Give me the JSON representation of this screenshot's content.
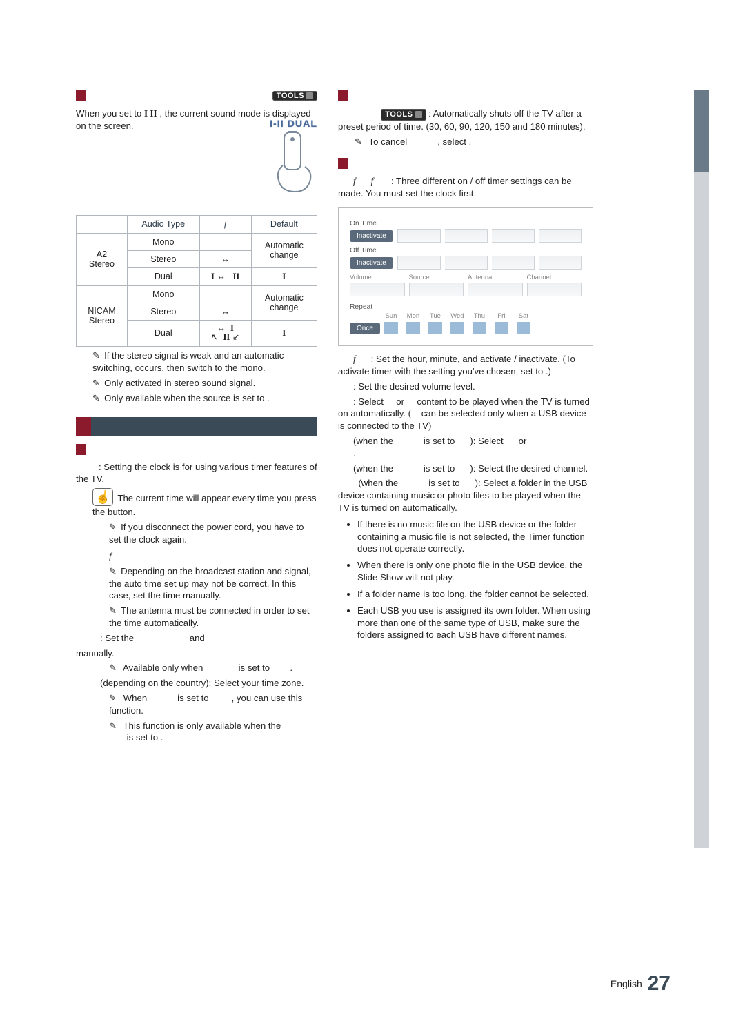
{
  "left_section_1": {
    "tools_label": "TOOLS",
    "intro_a": "When you set to",
    "intro_b": ", the current sound mode is displayed on the screen.",
    "i_ii": "I  II",
    "dual_badge": "I-II DUAL"
  },
  "audio_table": {
    "headers": {
      "col1": "",
      "col2": "Audio Type",
      "col3": "",
      "col4": "Default"
    },
    "a2_rowspan": "A2\nStereo",
    "nicam_rowspan": "NICAM\nStereo",
    "rows_a2": [
      {
        "type": "Mono",
        "mid": "",
        "def": "Automatic"
      },
      {
        "type": "Stereo",
        "mid": "↔",
        "def": "change"
      },
      {
        "type": "Dual",
        "mid_prefix": "I",
        "mid_arrow": "↔",
        "mid_suffix": "II",
        "def": "I"
      }
    ],
    "rows_nicam": [
      {
        "type": "Mono",
        "mid": "",
        "def": "Automatic"
      },
      {
        "type": "Stereo",
        "mid": "↔",
        "def": "change"
      },
      {
        "type": "Dual",
        "mid_up_arrow": "↔",
        "mid_up_suffix": "I",
        "mid_down_arrow": "↖",
        "mid_down_prefix": "II",
        "mid_down_suffix": "↙",
        "def": "I"
      }
    ],
    "notes": [
      "If the stereo signal is weak and an automatic switching, occurs, then switch to the mono.",
      "Only activated in stereo sound signal.",
      "Only available when the         source is set to      ."
    ]
  },
  "setup": {
    "clock_intro": ": Setting the clock is for using various timer features of the TV.",
    "hand_note": "The current time will appear every time you press the          button.",
    "note_disconnect": "If you disconnect the power cord, you have to set the clock again.",
    "auto_head": "",
    "auto_body": "Depending on the broadcast station and signal, the auto time set up may not be correct. In this case, set the time manually.",
    "antenna_note": "The antenna must be connected in order to set the time automatically.",
    "set_the": ": Set the",
    "and": "and",
    "manually": "manually.",
    "avail_only": "Available only when",
    "is_set_to_a": "is set to",
    "tz_a": "(depending on the country): Select your time zone.",
    "tz_b_when": "When",
    "tz_b_isset": "is set to",
    "tz_b_tail": ", you can use this function.",
    "tz_c": "This function is only available when the",
    "tz_c_isset": "is set to      ."
  },
  "right": {
    "sleep_tools": "TOOLS",
    "sleep_body": ": Automatically shuts off the TV after a preset period of time. (30, 60, 90, 120, 150 and 180 minutes).",
    "to_cancel": "To cancel",
    "select": ", select      .",
    "timer_intro": ": Three different on / off timer settings can be made. You must set the clock first.",
    "on_time": "On Time",
    "off_time": "Off Time",
    "inactivate": "Inactivate",
    "volume": "Volume",
    "source": "Source",
    "antenna": "Antenna",
    "channel": "Channel",
    "repeat": "Repeat",
    "once": "Once",
    "days": [
      "Sun",
      "Mon",
      "Tue",
      "Wed",
      "Thu",
      "Fri",
      "Sat"
    ],
    "p_onoff": ": Set the hour, minute, and activate / inactivate. (To activate timer with the setting you've chosen, set to             .)",
    "p_vol": ": Set the desired volume level.",
    "p_src_a": ": Select",
    "p_src_or": "or",
    "p_src_b": "content to be played when the TV is turned on automatically. (",
    "p_src_c": "can be selected only when a USB device is connected to the TV)",
    "p_line_ant": "(when the",
    "p_isset": "is set to",
    "p_select": "): Select",
    "p_or2": "or",
    "p_line_ch": "(when the",
    "p_select_ch": "): Select the desired channel.",
    "p_line_usb": "(when the",
    "p_select_usb": "): Select a folder in the USB device containing music or photo files to be played when the TV is turned on automatically.",
    "bullets": [
      "If there is no music file on the USB device or the folder containing a music file is not selected, the Timer function does not operate correctly.",
      "When there is only one photo file in the USB device, the Slide Show will not play.",
      "If a folder name is too long, the folder cannot be selected.",
      "Each USB you use is assigned its own folder. When using more than one of the same type of USB, make sure the folders assigned to each USB have different names."
    ]
  },
  "footer": {
    "lang": "English",
    "page": "27"
  }
}
